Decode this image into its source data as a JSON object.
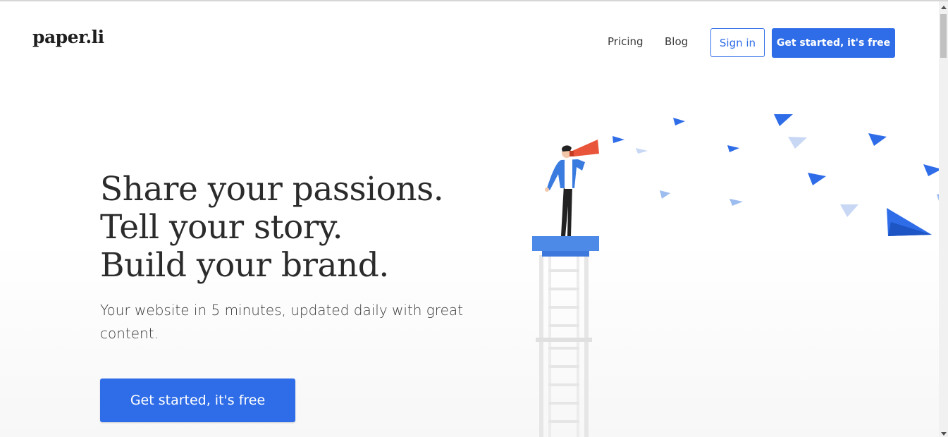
{
  "header": {
    "logo": "paper.li",
    "nav": {
      "pricing": "Pricing",
      "blog": "Blog"
    },
    "sign_in": "Sign in",
    "cta": "Get started, it's free"
  },
  "hero": {
    "headline": [
      "Share your passions.",
      "Tell your story.",
      "Build your brand."
    ],
    "subtitle": "Your website in 5 minutes, updated daily with great content.",
    "cta": "Get started, it's free"
  },
  "colors": {
    "brand_blue": "#2f6de8",
    "megaphone_orange": "#e8553a",
    "text_dark": "#2b2b2b"
  },
  "illustration": {
    "icon": "person-with-megaphone-on-ladder-with-paper-planes"
  }
}
